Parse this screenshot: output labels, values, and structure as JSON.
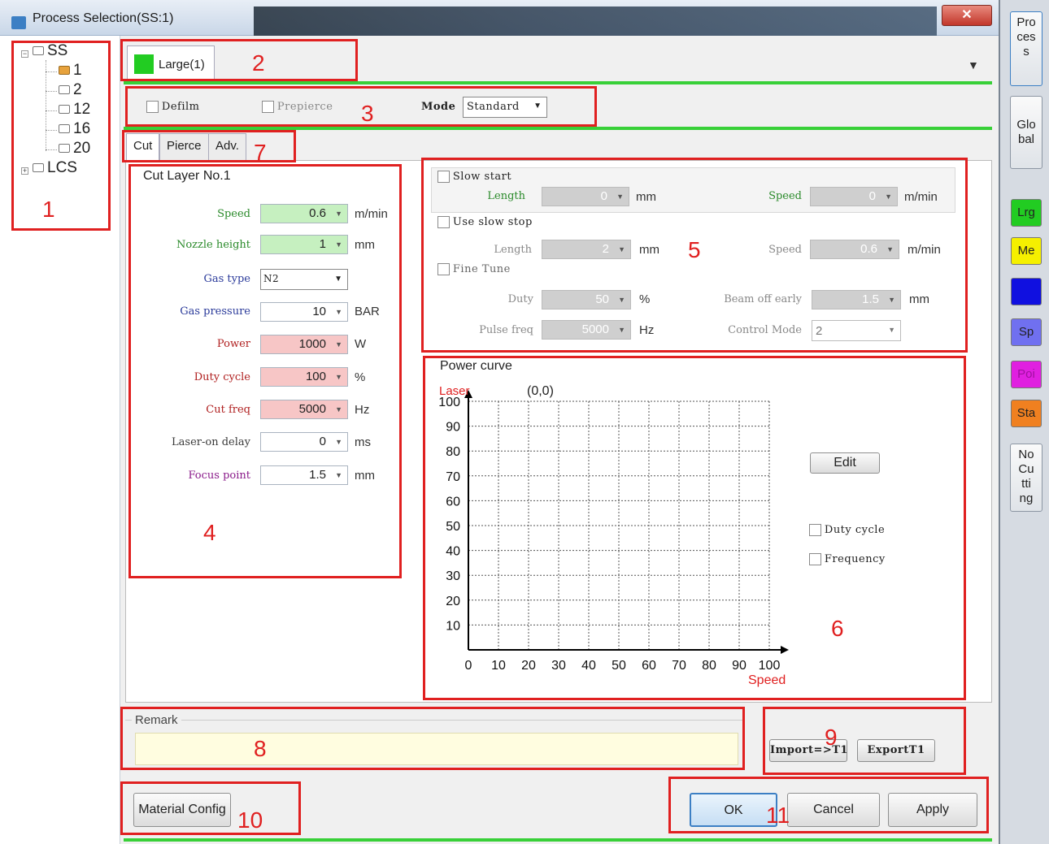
{
  "window": {
    "title": "Process Selection(SS:1)",
    "close": "✕"
  },
  "tree": {
    "root_ss": "SS",
    "children": [
      "1",
      "2",
      "12",
      "16",
      "20"
    ],
    "root_lcs": "LCS"
  },
  "layer_tab": {
    "label": "Large(1)",
    "swatch": "#22cc22",
    "menu_icon": "▼"
  },
  "options_row": {
    "defilm": "Defilm",
    "prepierce": "Prepierce",
    "mode_label": "Mode",
    "mode_value": "Standard"
  },
  "sub_tabs": [
    "Cut",
    "Pierce",
    "Adv."
  ],
  "cut_layer": {
    "title": "Cut Layer No.1",
    "fields": [
      {
        "label": "Speed",
        "value": "0.6",
        "unit": "m/min"
      },
      {
        "label": "Nozzle height",
        "value": "1",
        "unit": "mm"
      },
      {
        "label": "Gas type",
        "value": "N2",
        "unit": ""
      },
      {
        "label": "Gas pressure",
        "value": "10",
        "unit": "BAR"
      },
      {
        "label": "Power",
        "value": "1000",
        "unit": "W"
      },
      {
        "label": "Duty cycle",
        "value": "100",
        "unit": "%"
      },
      {
        "label": "Cut freq",
        "value": "5000",
        "unit": "Hz"
      },
      {
        "label": "Laser-on delay",
        "value": "0",
        "unit": "ms"
      },
      {
        "label": "Focus point",
        "value": "1.5",
        "unit": "mm"
      }
    ]
  },
  "slow": {
    "slow_start": "Slow start",
    "ss_length_label": "Length",
    "ss_length_value": "0",
    "ss_length_unit": "mm",
    "ss_speed_label": "Speed",
    "ss_speed_value": "0",
    "ss_speed_unit": "m/min",
    "slow_stop": "Use slow stop",
    "st_length_label": "Length",
    "st_length_value": "2",
    "st_length_unit": "mm",
    "st_speed_label": "Speed",
    "st_speed_value": "0.6",
    "st_speed_unit": "m/min",
    "fine_tune": "Fine Tune",
    "duty_label": "Duty",
    "duty_value": "50",
    "duty_unit": "%",
    "beam_label": "Beam off early",
    "beam_value": "1.5",
    "beam_unit": "mm",
    "pulse_label": "Pulse freq",
    "pulse_value": "5000",
    "pulse_unit": "Hz",
    "control_label": "Control Mode",
    "control_value": "2"
  },
  "power_curve": {
    "title": "Power curve",
    "edit": "Edit",
    "duty_cycle": "Duty cycle",
    "frequency": "Frequency"
  },
  "chart_data": {
    "type": "line",
    "ylabel": "Laser",
    "xlabel": "Speed",
    "annotation": "(0,0)",
    "x_ticks": [
      "0",
      "10",
      "20",
      "30",
      "40",
      "50",
      "60",
      "70",
      "80",
      "90",
      "100"
    ],
    "y_ticks": [
      "10",
      "20",
      "30",
      "40",
      "50",
      "60",
      "70",
      "80",
      "90",
      "100"
    ],
    "xlim": [
      0,
      100
    ],
    "ylim": [
      0,
      100
    ],
    "grid": true,
    "series": []
  },
  "remark": {
    "label": "Remark",
    "value": ""
  },
  "import_export": {
    "import": "Import=>T1",
    "export": "ExportT1"
  },
  "footer": {
    "material": "Material Config",
    "ok": "OK",
    "cancel": "Cancel",
    "apply": "Apply"
  },
  "right_strip": {
    "process": "Pro\nces\ns",
    "global": "Glo\nbal",
    "layers": [
      {
        "label": "Lrg",
        "color": "#22cc22"
      },
      {
        "label": "Me",
        "color": "#f5f000"
      },
      {
        "label": "",
        "color": "#1010e0"
      },
      {
        "label": "Sp",
        "color": "#7070f0"
      },
      {
        "label": "Poi",
        "color": "#e020e0"
      },
      {
        "label": "Sta",
        "color": "#f08020"
      }
    ],
    "no_cutting": "No\nCu\ntti\nng"
  },
  "annotations": [
    "1",
    "2",
    "3",
    "4",
    "5",
    "6",
    "7",
    "8",
    "9",
    "10",
    "11"
  ]
}
